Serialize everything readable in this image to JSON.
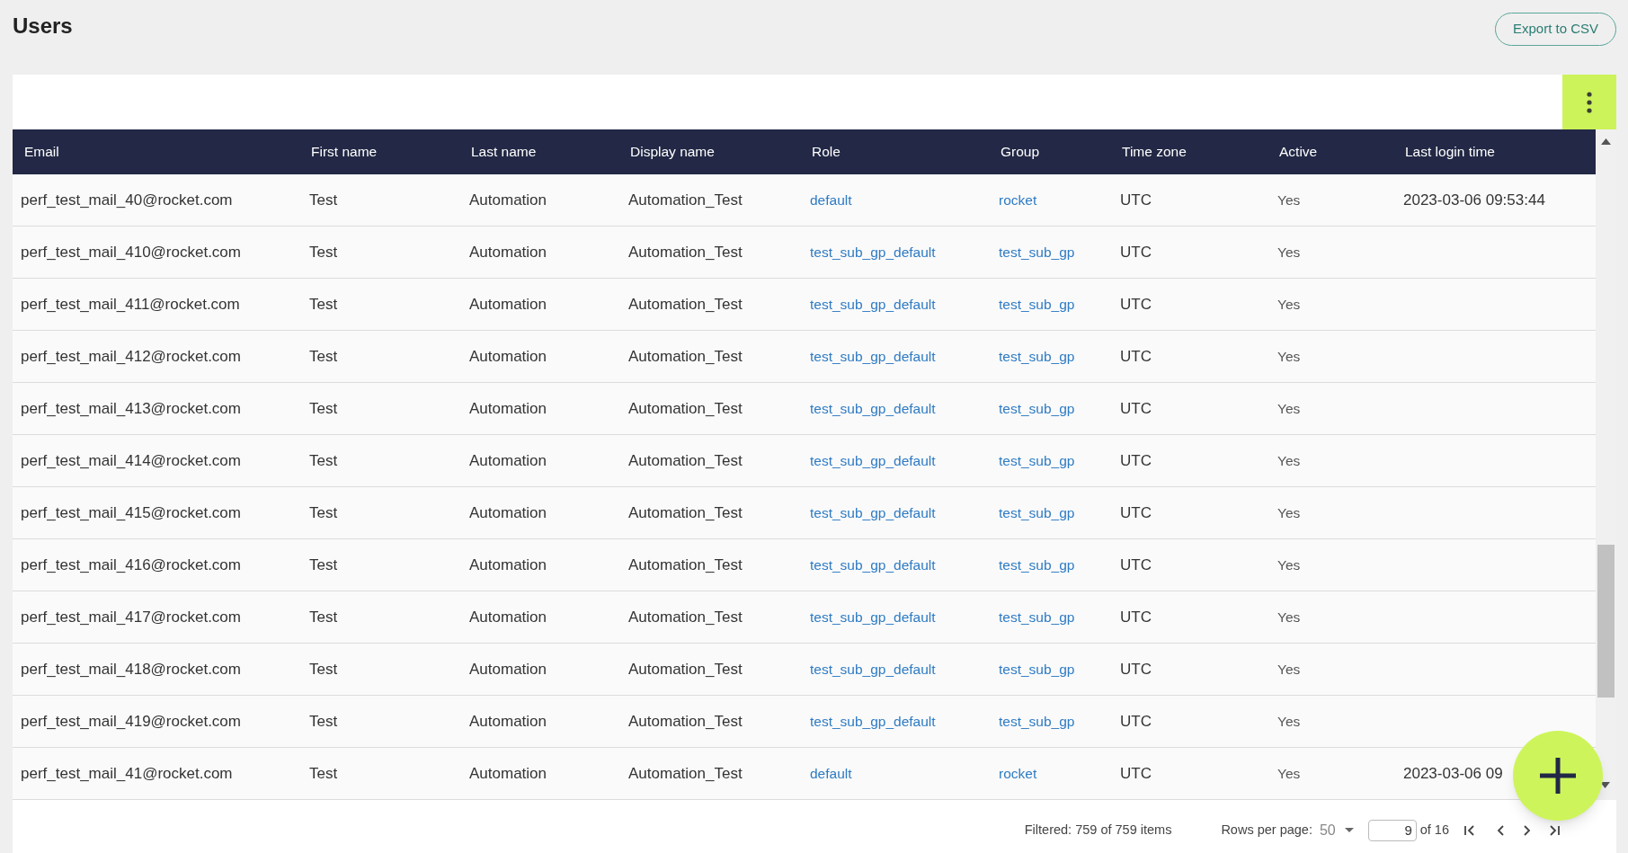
{
  "title": "Users",
  "export_button": "Export to CSV",
  "columns": [
    "Email",
    "First name",
    "Last name",
    "Display name",
    "Role",
    "Group",
    "Time zone",
    "Active",
    "Last login time"
  ],
  "rows": [
    {
      "email": "perf_test_mail_40@rocket.com",
      "first_name": "Test",
      "last_name": "Automation",
      "display_name": "Automation_Test",
      "role": "default",
      "group": "rocket",
      "time_zone": "UTC",
      "active": "Yes",
      "last_login": "2023-03-06 09:53:44"
    },
    {
      "email": "perf_test_mail_410@rocket.com",
      "first_name": "Test",
      "last_name": "Automation",
      "display_name": "Automation_Test",
      "role": "test_sub_gp_default",
      "group": "test_sub_gp",
      "time_zone": "UTC",
      "active": "Yes"
    },
    {
      "email": "perf_test_mail_411@rocket.com",
      "first_name": "Test",
      "last_name": "Automation",
      "display_name": "Automation_Test",
      "role": "test_sub_gp_default",
      "group": "test_sub_gp",
      "time_zone": "UTC",
      "active": "Yes"
    },
    {
      "email": "perf_test_mail_412@rocket.com",
      "first_name": "Test",
      "last_name": "Automation",
      "display_name": "Automation_Test",
      "role": "test_sub_gp_default",
      "group": "test_sub_gp",
      "time_zone": "UTC",
      "active": "Yes"
    },
    {
      "email": "perf_test_mail_413@rocket.com",
      "first_name": "Test",
      "last_name": "Automation",
      "display_name": "Automation_Test",
      "role": "test_sub_gp_default",
      "group": "test_sub_gp",
      "time_zone": "UTC",
      "active": "Yes"
    },
    {
      "email": "perf_test_mail_414@rocket.com",
      "first_name": "Test",
      "last_name": "Automation",
      "display_name": "Automation_Test",
      "role": "test_sub_gp_default",
      "group": "test_sub_gp",
      "time_zone": "UTC",
      "active": "Yes"
    },
    {
      "email": "perf_test_mail_415@rocket.com",
      "first_name": "Test",
      "last_name": "Automation",
      "display_name": "Automation_Test",
      "role": "test_sub_gp_default",
      "group": "test_sub_gp",
      "time_zone": "UTC",
      "active": "Yes"
    },
    {
      "email": "perf_test_mail_416@rocket.com",
      "first_name": "Test",
      "last_name": "Automation",
      "display_name": "Automation_Test",
      "role": "test_sub_gp_default",
      "group": "test_sub_gp",
      "time_zone": "UTC",
      "active": "Yes"
    },
    {
      "email": "perf_test_mail_417@rocket.com",
      "first_name": "Test",
      "last_name": "Automation",
      "display_name": "Automation_Test",
      "role": "test_sub_gp_default",
      "group": "test_sub_gp",
      "time_zone": "UTC",
      "active": "Yes"
    },
    {
      "email": "perf_test_mail_418@rocket.com",
      "first_name": "Test",
      "last_name": "Automation",
      "display_name": "Automation_Test",
      "role": "test_sub_gp_default",
      "group": "test_sub_gp",
      "time_zone": "UTC",
      "active": "Yes"
    },
    {
      "email": "perf_test_mail_419@rocket.com",
      "first_name": "Test",
      "last_name": "Automation",
      "display_name": "Automation_Test",
      "role": "test_sub_gp_default",
      "group": "test_sub_gp",
      "time_zone": "UTC",
      "active": "Yes"
    },
    {
      "email": "perf_test_mail_41@rocket.com",
      "first_name": "Test",
      "last_name": "Automation",
      "display_name": "Automation_Test",
      "role": "default",
      "group": "rocket",
      "time_zone": "UTC",
      "active": "Yes",
      "last_login": "2023-03-06 09"
    }
  ],
  "footer": {
    "filtered": "Filtered: 759 of 759 items",
    "rows_per_page_label": "Rows per page:",
    "rows_per_page": "50",
    "page": "9",
    "page_count": "of 16"
  }
}
